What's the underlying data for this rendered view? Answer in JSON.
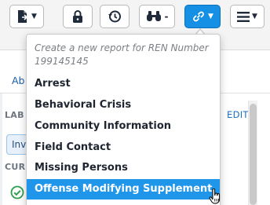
{
  "toolbar": {
    "buttons": [
      {
        "icon": "file-export-icon",
        "has_caret": true
      },
      {
        "icon": "lock-icon",
        "has_caret": false
      },
      {
        "icon": "history-clock-icon",
        "has_caret": false
      },
      {
        "icon": "binoculars-icon",
        "has_dash": true,
        "dash_label": "-"
      },
      {
        "icon": "link-icon",
        "has_caret": true,
        "active": true
      },
      {
        "icon": "hamburger-menu-icon",
        "has_caret": true
      }
    ]
  },
  "background": {
    "tab_label": "Ab",
    "section_label": "LAB",
    "edit_label": "EDIT",
    "pill_label": "Inv",
    "current_label": "CUR"
  },
  "dropdown": {
    "header": "Create a new report for REN Number 199145145",
    "items": [
      {
        "label": "Arrest"
      },
      {
        "label": "Behavioral Crisis"
      },
      {
        "label": "Community Information"
      },
      {
        "label": "Field Contact"
      },
      {
        "label": "Missing Persons"
      },
      {
        "label": "Offense Modifying Supplement",
        "highlighted": true
      }
    ]
  },
  "colors": {
    "accent": "#1690e4",
    "highlight": "#1f96ea",
    "header_text": "#7b7f86",
    "check_green": "#2e9e4f"
  }
}
